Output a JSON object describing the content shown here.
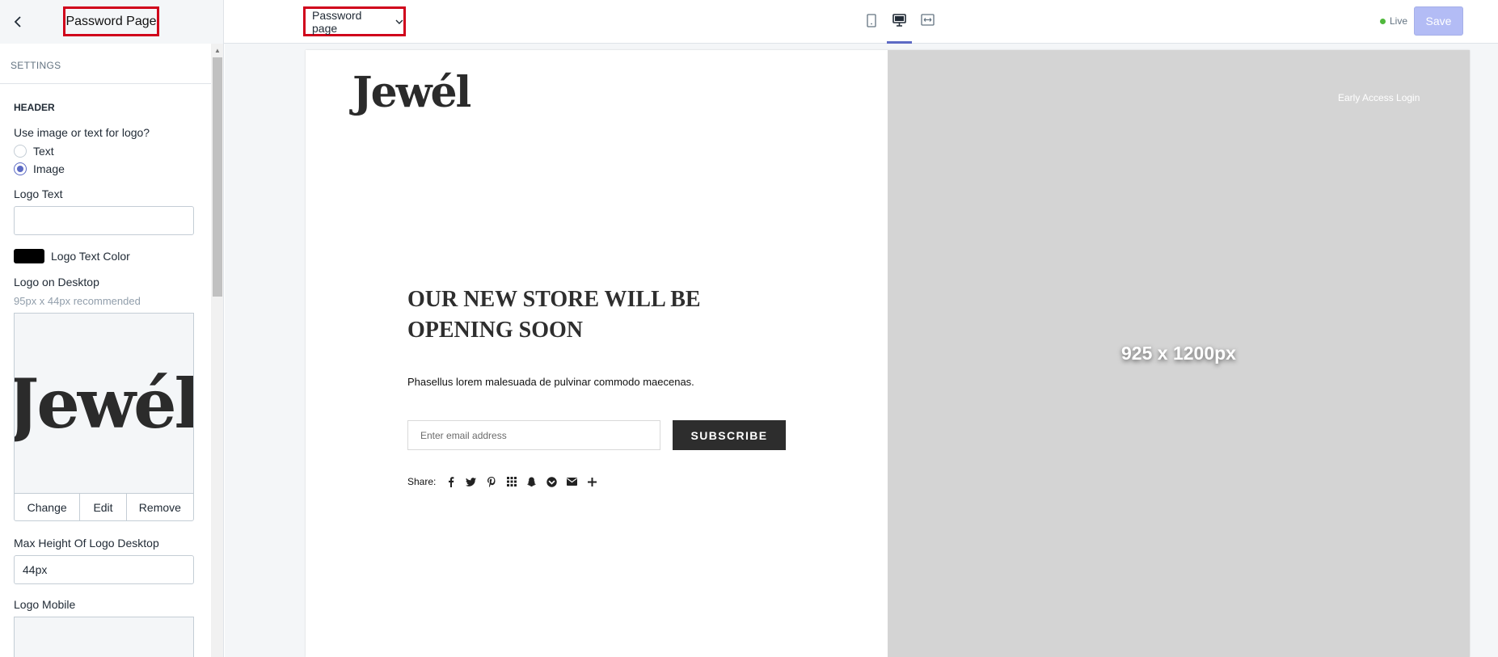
{
  "topbar": {
    "page_title": "Password Page",
    "page_select": "Password page",
    "live_label": "Live",
    "save_label": "Save",
    "devices": [
      "mobile-icon",
      "desktop-icon",
      "fullscreen-icon"
    ]
  },
  "sidebar": {
    "settings_heading": "SETTINGS",
    "section_title": "HEADER",
    "logo_type_label": "Use image or text for logo?",
    "radio_text": "Text",
    "radio_image": "Image",
    "selected_logo_type": "Image",
    "logo_text_label": "Logo Text",
    "logo_text_value": "",
    "logo_text_color_label": "Logo Text Color",
    "logo_text_color": "#000000",
    "logo_desktop_label": "Logo on Desktop",
    "logo_desktop_hint": "95px x 44px recommended",
    "logo_image_text": "Jewél",
    "change_label": "Change",
    "edit_label": "Edit",
    "remove_label": "Remove",
    "max_height_label": "Max Height Of Logo Desktop",
    "max_height_value": "44px",
    "logo_mobile_label": "Logo Mobile"
  },
  "preview": {
    "logo": "Jewél",
    "headline_line1": "OUR NEW STORE WILL BE",
    "headline_line2": "OPENING SOON",
    "description": "Phasellus lorem malesuada de pulvinar commodo maecenas.",
    "email_placeholder": "Enter email address",
    "subscribe_label": "SUBSCRIBE",
    "share_label": "Share:",
    "share_icons": [
      "facebook-icon",
      "twitter-icon",
      "pinterest-icon",
      "grid-icon",
      "snapchat-icon",
      "pocket-icon",
      "email-icon",
      "plus-icon"
    ],
    "early_access": "Early Access Login",
    "image_placeholder": "925 x 1200px"
  },
  "colors": {
    "accent": "#5c6ac4",
    "live_dot": "#50b83c",
    "annotation_box": "#d0021b",
    "subscribe_bg": "#2d2d2d",
    "image_bg": "#d4d4d4"
  }
}
